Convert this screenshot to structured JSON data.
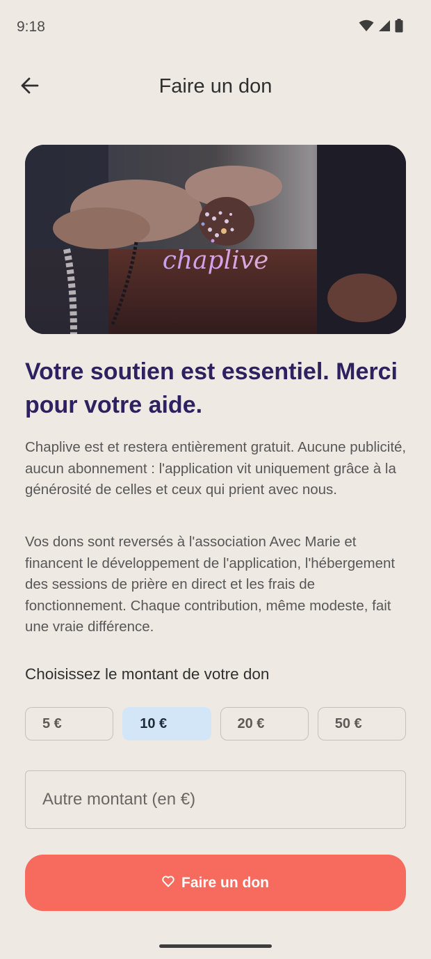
{
  "status_bar": {
    "time": "9:18",
    "icons": [
      "wifi-icon",
      "signal-icon",
      "battery-icon"
    ]
  },
  "app_bar": {
    "back_icon": "arrow-left-icon",
    "title": "Faire un don"
  },
  "hero": {
    "logo_text": "chaplive"
  },
  "content": {
    "headline": "Votre soutien est essentiel. Merci pour votre aide.",
    "paragraph_1": "Chaplive est et restera entièrement gratuit. Aucune publicité, aucun abonnement : l'application vit uniquement grâce à la générosité de celles et ceux qui prient avec nous.",
    "paragraph_2": "Vos dons sont reversés à l'association Avec Marie et financent le développement de l'application, l'hébergement des sessions de prière en direct et les frais de fonctionnement. Chaque contribution, même modeste, fait une vraie différence."
  },
  "donation": {
    "amount_label": "Choisissez le montant de votre don",
    "amounts": [
      {
        "label": "5 €",
        "selected": false
      },
      {
        "label": "10 €",
        "selected": true
      },
      {
        "label": "20 €",
        "selected": false
      },
      {
        "label": "50 €",
        "selected": false
      }
    ],
    "other_amount_placeholder": "Autre montant (en €)",
    "other_amount_value": "",
    "submit_icon": "heart-icon",
    "submit_label": "Faire un don"
  },
  "colors": {
    "background": "#efe9e3",
    "headline": "#2e2160",
    "selected_chip": "#d3e6f8",
    "primary_button": "#f76a5e"
  }
}
